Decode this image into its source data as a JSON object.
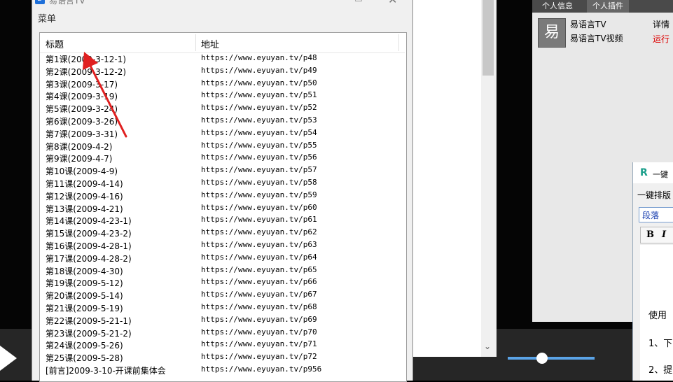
{
  "window": {
    "title": "易语言TV",
    "menu": "菜单",
    "icon": "app-icon",
    "controls": {
      "min": "—",
      "max": "☐",
      "close": "✕"
    }
  },
  "list": {
    "columns": {
      "title": "标题",
      "address": "地址"
    },
    "rows": [
      {
        "title": "第1课(2009-3-12-1)",
        "url": "https://www.eyuyan.tv/p48"
      },
      {
        "title": "第2课(2009-3-12-2)",
        "url": "https://www.eyuyan.tv/p49"
      },
      {
        "title": "第3课(2009-3-17)",
        "url": "https://www.eyuyan.tv/p50"
      },
      {
        "title": "第4课(2009-3-19)",
        "url": "https://www.eyuyan.tv/p51"
      },
      {
        "title": "第5课(2009-3-24)",
        "url": "https://www.eyuyan.tv/p52"
      },
      {
        "title": "第6课(2009-3-26)",
        "url": "https://www.eyuyan.tv/p53"
      },
      {
        "title": "第7课(2009-3-31)",
        "url": "https://www.eyuyan.tv/p54"
      },
      {
        "title": "第8课(2009-4-2)",
        "url": "https://www.eyuyan.tv/p55"
      },
      {
        "title": "第9课(2009-4-7)",
        "url": "https://www.eyuyan.tv/p56"
      },
      {
        "title": "第10课(2009-4-9)",
        "url": "https://www.eyuyan.tv/p57"
      },
      {
        "title": "第11课(2009-4-14)",
        "url": "https://www.eyuyan.tv/p58"
      },
      {
        "title": "第12课(2009-4-16)",
        "url": "https://www.eyuyan.tv/p59"
      },
      {
        "title": "第13课(2009-4-21)",
        "url": "https://www.eyuyan.tv/p60"
      },
      {
        "title": "第14课(2009-4-23-1)",
        "url": "https://www.eyuyan.tv/p61"
      },
      {
        "title": "第15课(2009-4-23-2)",
        "url": "https://www.eyuyan.tv/p62"
      },
      {
        "title": "第16课(2009-4-28-1)",
        "url": "https://www.eyuyan.tv/p63"
      },
      {
        "title": "第17课(2009-4-28-2)",
        "url": "https://www.eyuyan.tv/p64"
      },
      {
        "title": "第18课(2009-4-30)",
        "url": "https://www.eyuyan.tv/p65"
      },
      {
        "title": "第19课(2009-5-12)",
        "url": "https://www.eyuyan.tv/p66"
      },
      {
        "title": "第20课(2009-5-14)",
        "url": "https://www.eyuyan.tv/p67"
      },
      {
        "title": "第21课(2009-5-19)",
        "url": "https://www.eyuyan.tv/p68"
      },
      {
        "title": "第22课(2009-5-21-1)",
        "url": "https://www.eyuyan.tv/p69"
      },
      {
        "title": "第23课(2009-5-21-2)",
        "url": "https://www.eyuyan.tv/p70"
      },
      {
        "title": "第24课(2009-5-26)",
        "url": "https://www.eyuyan.tv/p71"
      },
      {
        "title": "第25课(2009-5-28)",
        "url": "https://www.eyuyan.tv/p72"
      },
      {
        "title": "[前言]2009-3-10-开课前集体会",
        "url": "https://www.eyuyan.tv/p956"
      }
    ]
  },
  "right_app": {
    "tab1": "个人信息",
    "tab2": "个人插件",
    "logo_char": "易",
    "name": "易语言TV",
    "subtitle": "易语言TV视频",
    "detail": "详情",
    "run": "运行"
  },
  "editor": {
    "title": "一键",
    "menu": "一键排版",
    "paragraph": "段落",
    "bold": "B",
    "italic": "I",
    "lines": [
      "   ",
      "   ",
      "使用",
      "1、下",
      "2、提"
    ]
  },
  "colors": {
    "accent": "#1e6fd9",
    "arrow": "#e02020",
    "volume": "#5aa3e6",
    "run_text": "#dd0000"
  }
}
